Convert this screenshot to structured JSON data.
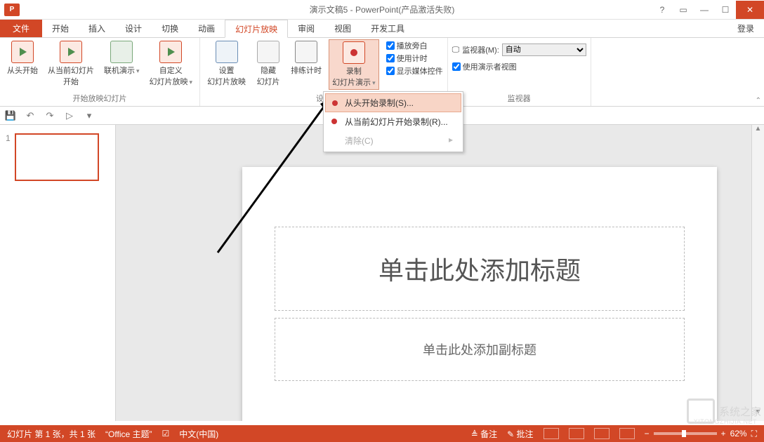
{
  "titlebar": {
    "appicon_text": "P",
    "title": "演示文稿5 - PowerPoint(产品激活失败)",
    "help": "?",
    "ribbonopts": "▭",
    "min": "—",
    "max": "☐",
    "close": "✕"
  },
  "tabs": {
    "file": "文件",
    "items": [
      "开始",
      "插入",
      "设计",
      "切换",
      "动画",
      "幻灯片放映",
      "审阅",
      "视图",
      "开发工具"
    ],
    "active_index": 5,
    "signin": "登录"
  },
  "ribbon": {
    "g1": {
      "label": "开始放映幻灯片",
      "from_begin": "从头开始",
      "from_current": "从当前幻灯片\n开始",
      "online": "联机演示",
      "custom": "自定义\n幻灯片放映"
    },
    "g2": {
      "label": "设置",
      "setup": "设置\n幻灯片放映",
      "hide": "隐藏\n幻灯片",
      "rehearse": "排练计时",
      "record": "录制\n幻灯片演示",
      "chk_narr": "播放旁白",
      "chk_timing": "使用计时",
      "chk_media": "显示媒体控件"
    },
    "g3": {
      "label": "监视器",
      "monitor_label": "监视器(M):",
      "monitor_value": "自动",
      "presenter": "使用演示者视图"
    }
  },
  "dropdown": {
    "item1": "从头开始录制(S)...",
    "item2": "从当前幻灯片开始录制(R)...",
    "item3": "清除(C)"
  },
  "qat": {
    "save": "💾",
    "undo": "↶",
    "redo": "↷",
    "start": "▷",
    "more": "▾"
  },
  "thumbs": {
    "num1": "1"
  },
  "slide": {
    "title_ph": "单击此处添加标题",
    "sub_ph": "单击此处添加副标题"
  },
  "status": {
    "slideinfo": "幻灯片 第 1 张，共 1 张",
    "theme": "“Office 主题”",
    "lang": "中文(中国)",
    "notes": "备注",
    "comments": "批注",
    "zoom": "62%"
  },
  "wm": {
    "text": "系统之家",
    "url": "XITONGZHIJIA.NET"
  }
}
